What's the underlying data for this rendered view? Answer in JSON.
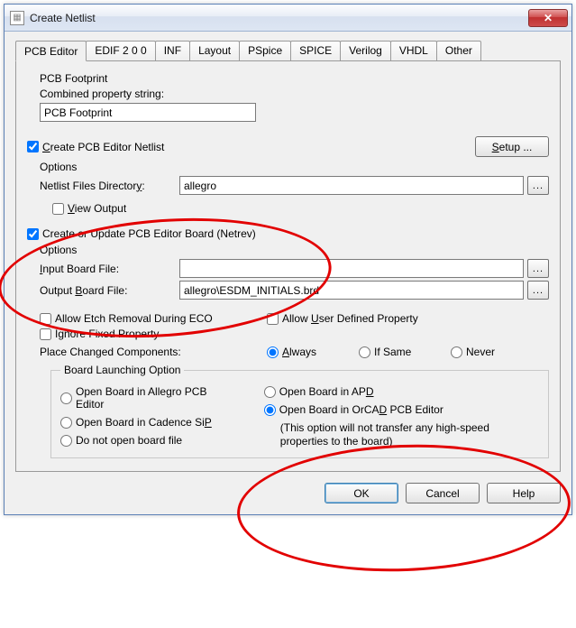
{
  "window": {
    "title": "Create Netlist",
    "close_glyph": "✕"
  },
  "tabs": [
    "PCB Editor",
    "EDIF 2 0 0",
    "INF",
    "Layout",
    "PSpice",
    "SPICE",
    "Verilog",
    "VHDL",
    "Other"
  ],
  "footprint": {
    "section": "PCB Footprint",
    "combined_label": "Combined property string:",
    "value": "PCB Footprint"
  },
  "create_netlist": {
    "label_pre": "C",
    "label_rest": "reate PCB Editor Netlist",
    "setup_label_pre": "S",
    "setup_label_rest": "etup ..."
  },
  "options1": {
    "header": "Options",
    "dir_label_pre": "Netlist Files Director",
    "dir_label_und": "y",
    "dir_label_post": ":",
    "dir_value": "allegro",
    "view_label_und": "V",
    "view_label_rest": "iew Output"
  },
  "netrev": {
    "label": "Create or Update PCB Editor Board (Netrev)"
  },
  "options2": {
    "header": "Options",
    "input_label_pre": "I",
    "input_label_rest": "nput Board File:",
    "input_value": "",
    "output_label_pre": "Output ",
    "output_label_und": "B",
    "output_label_rest": "oard File:",
    "output_value": "allegro\\ESDM_INITIALS.brd",
    "etch_label": "Allow Etch Removal During ECO",
    "userprop_pre": "Allow ",
    "userprop_und": "U",
    "userprop_rest": "ser Defined Property",
    "ignore_label": "Ignore Fixed Property",
    "place_label": "Place Changed Components:",
    "radio_always_und": "A",
    "radio_always_rest": "lways",
    "radio_ifsame": "If Same",
    "radio_never": "Never"
  },
  "launch": {
    "legend": "Board Launching Option",
    "r_allegro_pre": "Open Board in Alle",
    "r_allegro_und": "g",
    "r_allegro_post": "ro PCB Editor",
    "r_sip_pre": "Open Board in Cadence Si",
    "r_sip_und": "P",
    "r_none": "Do not open board file",
    "r_apd_pre": "Open Board in AP",
    "r_apd_und": "D",
    "r_orcad_pre": "Open Board in OrCA",
    "r_orcad_und": "D",
    "r_orcad_post": " PCB Editor",
    "r_orcad_note": "(This option will not transfer any high-speed properties to the board)"
  },
  "footer": {
    "ok": "OK",
    "cancel": "Cancel",
    "help": "Help"
  },
  "browse": "..."
}
